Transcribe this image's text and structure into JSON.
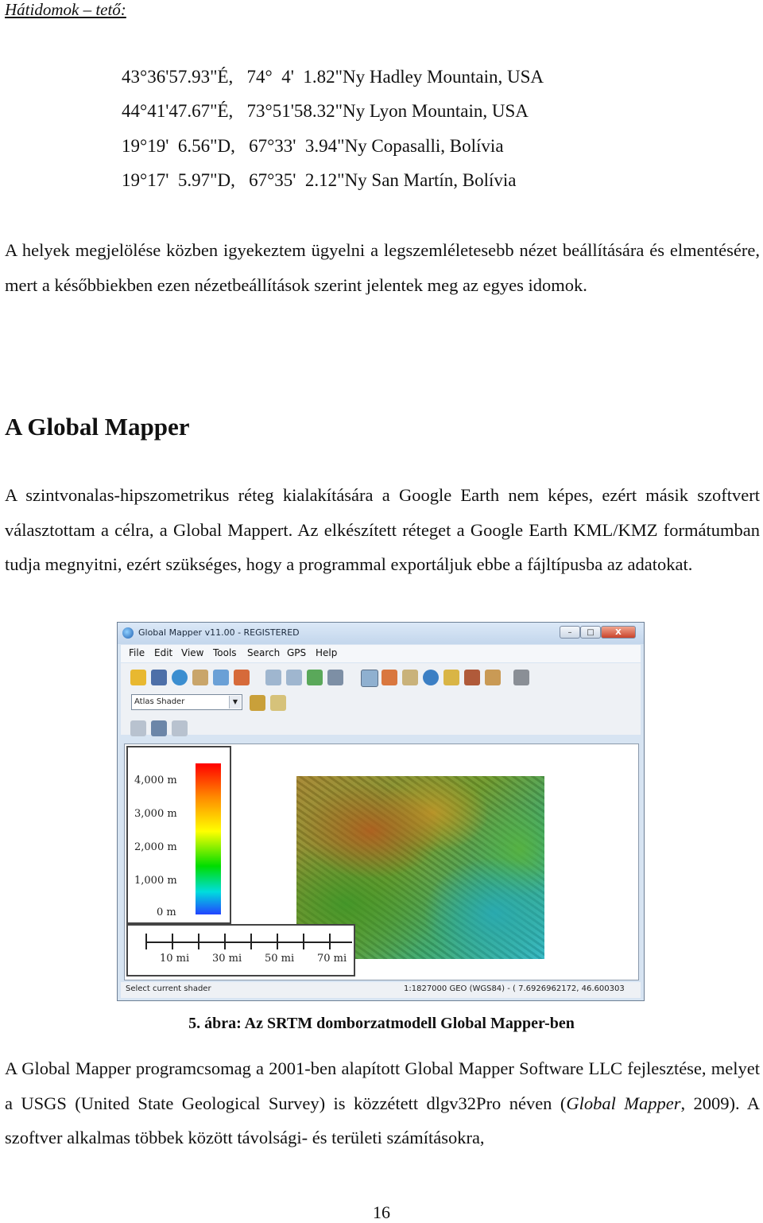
{
  "header": "Hátidomok – tető:",
  "coordinates": [
    "43°36'57.93\"É,   74°  4'  1.82\"Ny Hadley Mountain, USA",
    "44°41'47.67\"É,   73°51'58.32\"Ny Lyon Mountain, USA",
    "19°19'  6.56\"D,   67°33'  3.94\"Ny Copasalli, Bolívia",
    "19°17'  5.97\"D,   67°35'  2.12\"Ny San Martín, Bolívia"
  ],
  "para1": "A helyek megjelölése közben igyekeztem ügyelni a legszemléletesebb nézet beállítására és elmentésére, mert a későbbiekben ezen nézetbeállítások szerint jelentek meg az egyes idomok.",
  "heading": "A Global Mapper",
  "para2": "A szintvonalas-hipszometrikus réteg kialakítására a Google Earth nem képes, ezért másik szoftvert választottam a célra, a Global Mappert. Az elkészített réteget a Google Earth KML/KMZ formátumban tudja megnyitni, ezért szükséges, hogy a programmal exportáljuk ebbe a fájltípusba az adatokat.",
  "figure": {
    "window_title": "Global Mapper v11.00 - REGISTERED",
    "window_buttons": {
      "minimize": "–",
      "maximize": "□",
      "close": "X"
    },
    "menu": [
      "File",
      "Edit",
      "View",
      "Tools",
      "Search",
      "GPS",
      "Help"
    ],
    "shader_select": "Atlas Shader",
    "legend_labels": [
      "4,000 m",
      "3,000 m",
      "2,000 m",
      "1,000 m",
      "0 m"
    ],
    "scale_labels": [
      "10 mi",
      "30 mi",
      "50 mi",
      "70 mi"
    ],
    "status_left": "Select current shader",
    "status_right": "1:1827000  GEO (WGS84) - ( 7.6926962172, 46.600303",
    "caption": "5. ábra: Az SRTM domborzatmodell Global Mapper-ben",
    "colors": {
      "window_frame": "#d7e4f2",
      "close_button": "#c9432b"
    }
  },
  "para3_before_italic": "A Global Mapper programcsomag a 2001-ben alapított Global Mapper Software LLC fejlesztése, melyet a USGS (United State Geological Survey) is közzétett dlgv32Pro néven (",
  "para3_italic": "Global Mapper",
  "para3_after_italic": ", 2009). A szoftver alkalmas többek között távolsági- és területi számításokra,",
  "page_number": "16"
}
